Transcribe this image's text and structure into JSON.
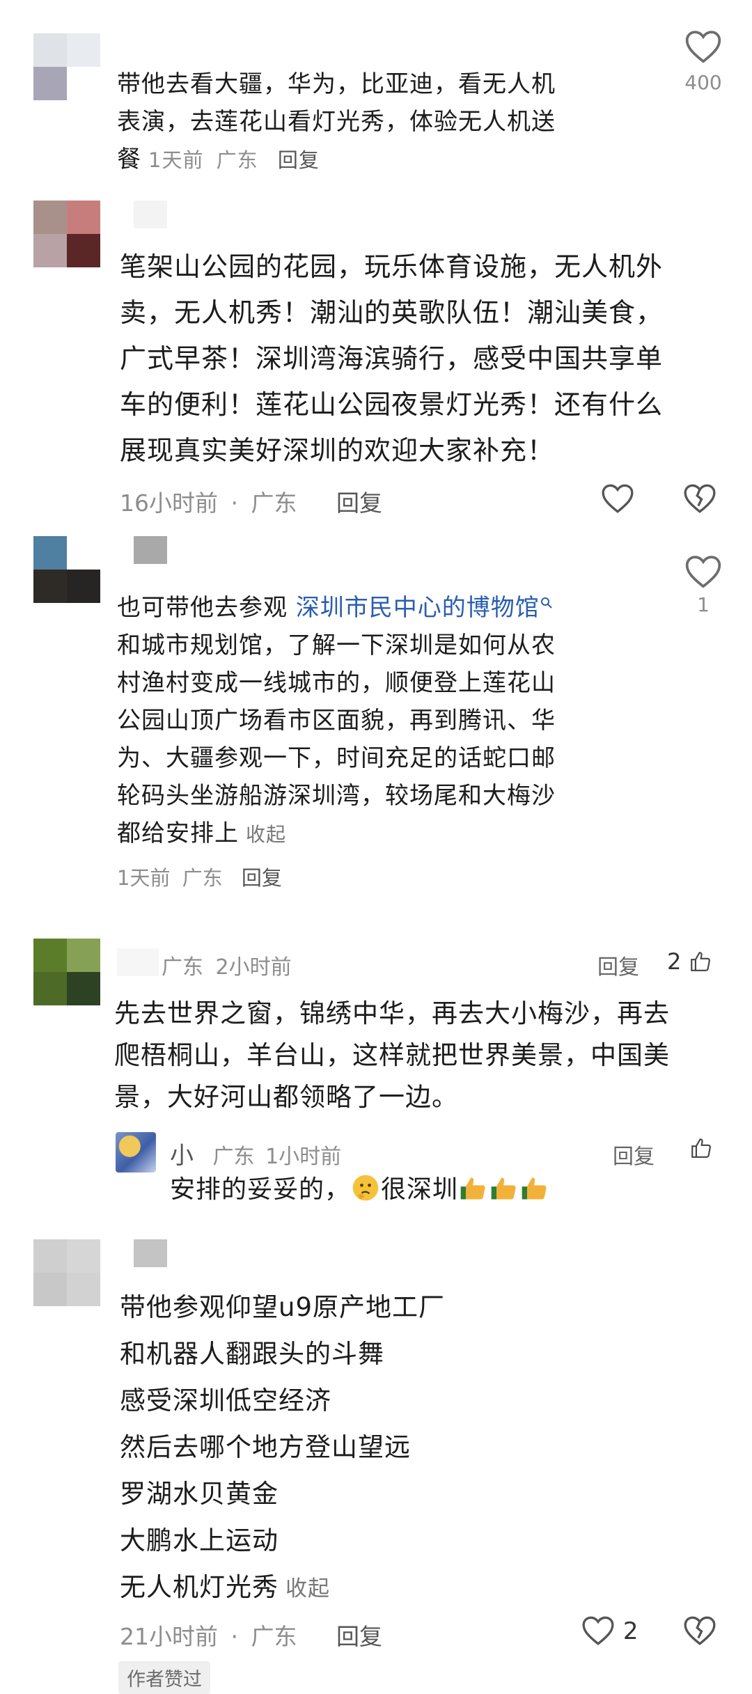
{
  "comments": [
    {
      "text": "带他去看大疆，华为，比亚迪，看无人机表演，去莲花山看灯光秀，体验无人机送餐",
      "lines": [
        "带他去看大疆，华为，比亚迪，看无人机",
        "表演，去莲花山看灯光秀，体验无人机送",
        "餐"
      ],
      "time": "1天前",
      "location": "广东",
      "reply_label": "回复",
      "likes": "400",
      "avatar_colors": [
        "#dfe2e6",
        "#e8ebef",
        "#a8a6b6",
        "#ffffff"
      ]
    },
    {
      "lines": [
        "笔架山公园的花园，玩乐体育设施，无人机外",
        "卖，无人机秀！潮汕的英歌队伍！潮汕美食，",
        "广式早茶！深圳湾海滨骑行，感受中国共享单",
        "车的便利！莲花山公园夜景灯光秀！还有什么",
        "展现真实美好深圳的欢迎大家补充！"
      ],
      "time": "16小时前",
      "separator": "·",
      "location": "广东",
      "reply_label": "回复",
      "avatar_colors": [
        "#a8918a",
        "#c87d7d",
        "#b8a2a6",
        "#5a2626"
      ]
    },
    {
      "link_prefix": "也可带他去参观",
      "link_text": "深圳市民中心的博物馆",
      "lines": [
        "和城市规划馆，了解一下深圳是如何从农",
        "村渔村变成一线城市的，顺便登上莲花山",
        "公园山顶广场看市区面貌，再到腾讯、华",
        "为、大疆参观一下，时间充足的话蛇口邮",
        "轮码头坐游船游深圳湾，较场尾和大梅沙",
        "都给安排上"
      ],
      "collapse_label": "收起",
      "time": "1天前",
      "location": "广东",
      "reply_label": "回复",
      "likes": "1",
      "avatar_colors": [
        "#4f7fa1",
        "#ffffff",
        "#2e2b27",
        "#262524"
      ]
    },
    {
      "location": "广东",
      "time": "2小时前",
      "reply_label": "回复",
      "likes": "2",
      "lines": [
        "先去世界之窗，锦绣中华，再去大小梅沙，再去",
        "爬梧桐山，羊台山，这样就把世界美景，中国美",
        "景，大好河山都领略了一边。"
      ],
      "avatar_colors": [
        "#5b7d2a",
        "#86a155",
        "#4d6a26",
        "#2c4223"
      ],
      "reply": {
        "name": "小",
        "location": "广东",
        "time": "1小时前",
        "reply_label": "回复",
        "text": "安排的妥妥的，",
        "text_after": "很深圳"
      }
    },
    {
      "lines": [
        "带他参观仰望u9原产地工厂",
        "和机器人翻跟头的斗舞",
        "感受深圳低空经济",
        "然后去哪个地方登山望远",
        "罗湖水贝黄金",
        "大鹏水上运动",
        "无人机灯光秀"
      ],
      "collapse_label": "收起",
      "time": "21小时前",
      "separator": "·",
      "location": "广东",
      "reply_label": "回复",
      "likes": "2",
      "author_badge": "作者赞过",
      "avatar_colors": [
        "#cfcfcf",
        "#d6d6d6",
        "#c8c8c8",
        "#d2d2d2"
      ]
    }
  ],
  "colors": {
    "link": "#2a5db0",
    "meta": "#8d8d8d",
    "text": "#1c1c1c"
  }
}
